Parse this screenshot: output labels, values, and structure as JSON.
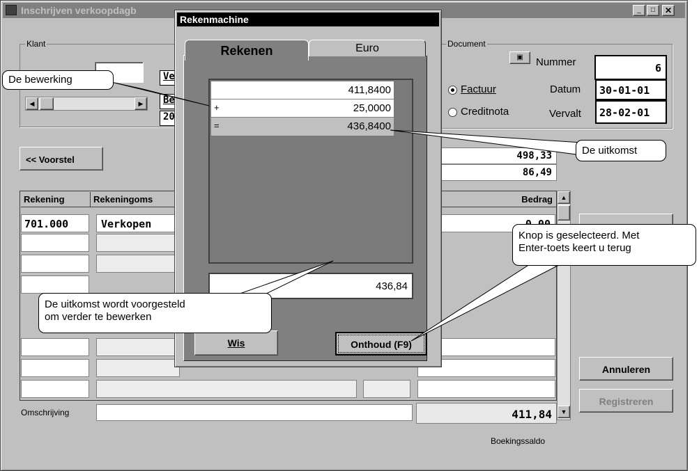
{
  "main_window": {
    "title": "Inschrijven verkoopdagb",
    "klant_label": "Klant",
    "klant_fields": [
      "Ve",
      "Be",
      "20"
    ],
    "document_label": "Document",
    "nummer_label": "Nummer",
    "nummer_value": "6",
    "factuur_label": "Factuur",
    "creditnota_label": "Creditnota",
    "datum_label": "Datum",
    "datum_value": "30-01-01",
    "vervalt_label": "Vervalt",
    "vervalt_value": "28-02-01",
    "voorstel_button": "<< Voorstel",
    "total1": "498,33",
    "total2": "86,49",
    "col_rekening": "Rekening",
    "col_omschrijving": "Rekeningoms",
    "col_bedrag": "Bedrag",
    "row1_rekening": "701.000",
    "row1_omschrijving": "Verkopen",
    "row1_bedrag": "0,00",
    "omschrijving_label": "Omschrijving",
    "saldo_value": "411,84",
    "saldo_label": "Boekingssaldo",
    "annuleren_button": "Annuleren",
    "registreren_button": "Registreren"
  },
  "calculator": {
    "title": "Rekenmachine",
    "tabs": [
      "Rekenen",
      "Euro"
    ],
    "tape": [
      {
        "op": "",
        "value": "411,8400"
      },
      {
        "op": "+",
        "value": "25,0000"
      },
      {
        "op": "=",
        "value": "436,8400"
      }
    ],
    "result": "436,84",
    "wis_button": "Wis",
    "onthoud_button": "Onthoud (F9)"
  },
  "callouts": {
    "bewerking": "De bewerking",
    "uitkomst": "De uitkomst",
    "knop_line1": "Knop is geselecteerd. Met",
    "knop_line2": "Enter-toets keert u terug",
    "voorgesteld_line1": "De uitkomst wordt voorgesteld",
    "voorgesteld_line2": "om verder te bewerken"
  }
}
